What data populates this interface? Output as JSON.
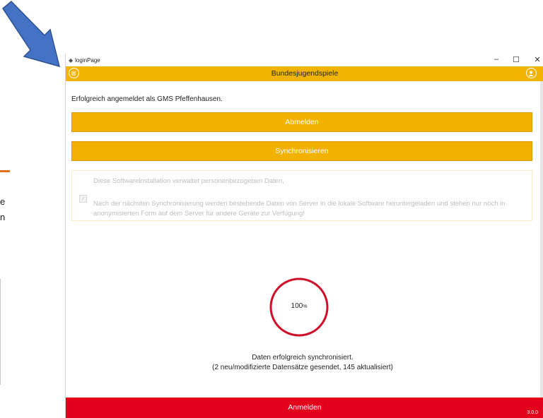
{
  "background": {
    "fragment_1": "e",
    "fragment_2": "n"
  },
  "window": {
    "title": "loginPage",
    "controls": {
      "minimize": "–",
      "maximize": "☐",
      "close": "✕"
    }
  },
  "header": {
    "title": "Bundesjugendspiele"
  },
  "main": {
    "login_message": "Erfolgreich angemeldet als GMS Pfeffenhausen.",
    "logout_button": "Abmelden",
    "sync_button": "Synchronisieren",
    "consent": {
      "line1": "Diese Softwareinstallation verwaltet personenbezogenen Daten,",
      "line2": "Nach der nächsten Synchronisierung werden bestehende Daten von Server in die lokale Software heruntergeladen und stehen nur noch in anonymisierten Form auf dem Server für andere Geräte zur Verfügung!",
      "checked": true
    },
    "progress": {
      "value": "100",
      "unit": "%",
      "fraction": 1.0
    },
    "status_line1": "Daten erfolgreich synchronisiert.",
    "status_line2": "(2 neu/modifizierte Datensätze gesendet, 145 aktualisiert)"
  },
  "footer": {
    "login_button": "Anmelden",
    "version": "3.0.0"
  },
  "colors": {
    "header": "#f0b400",
    "button": "#f2b100",
    "footer": "#e3001b",
    "progress_ring": "#d0102a",
    "arrow": "#4472c4"
  }
}
